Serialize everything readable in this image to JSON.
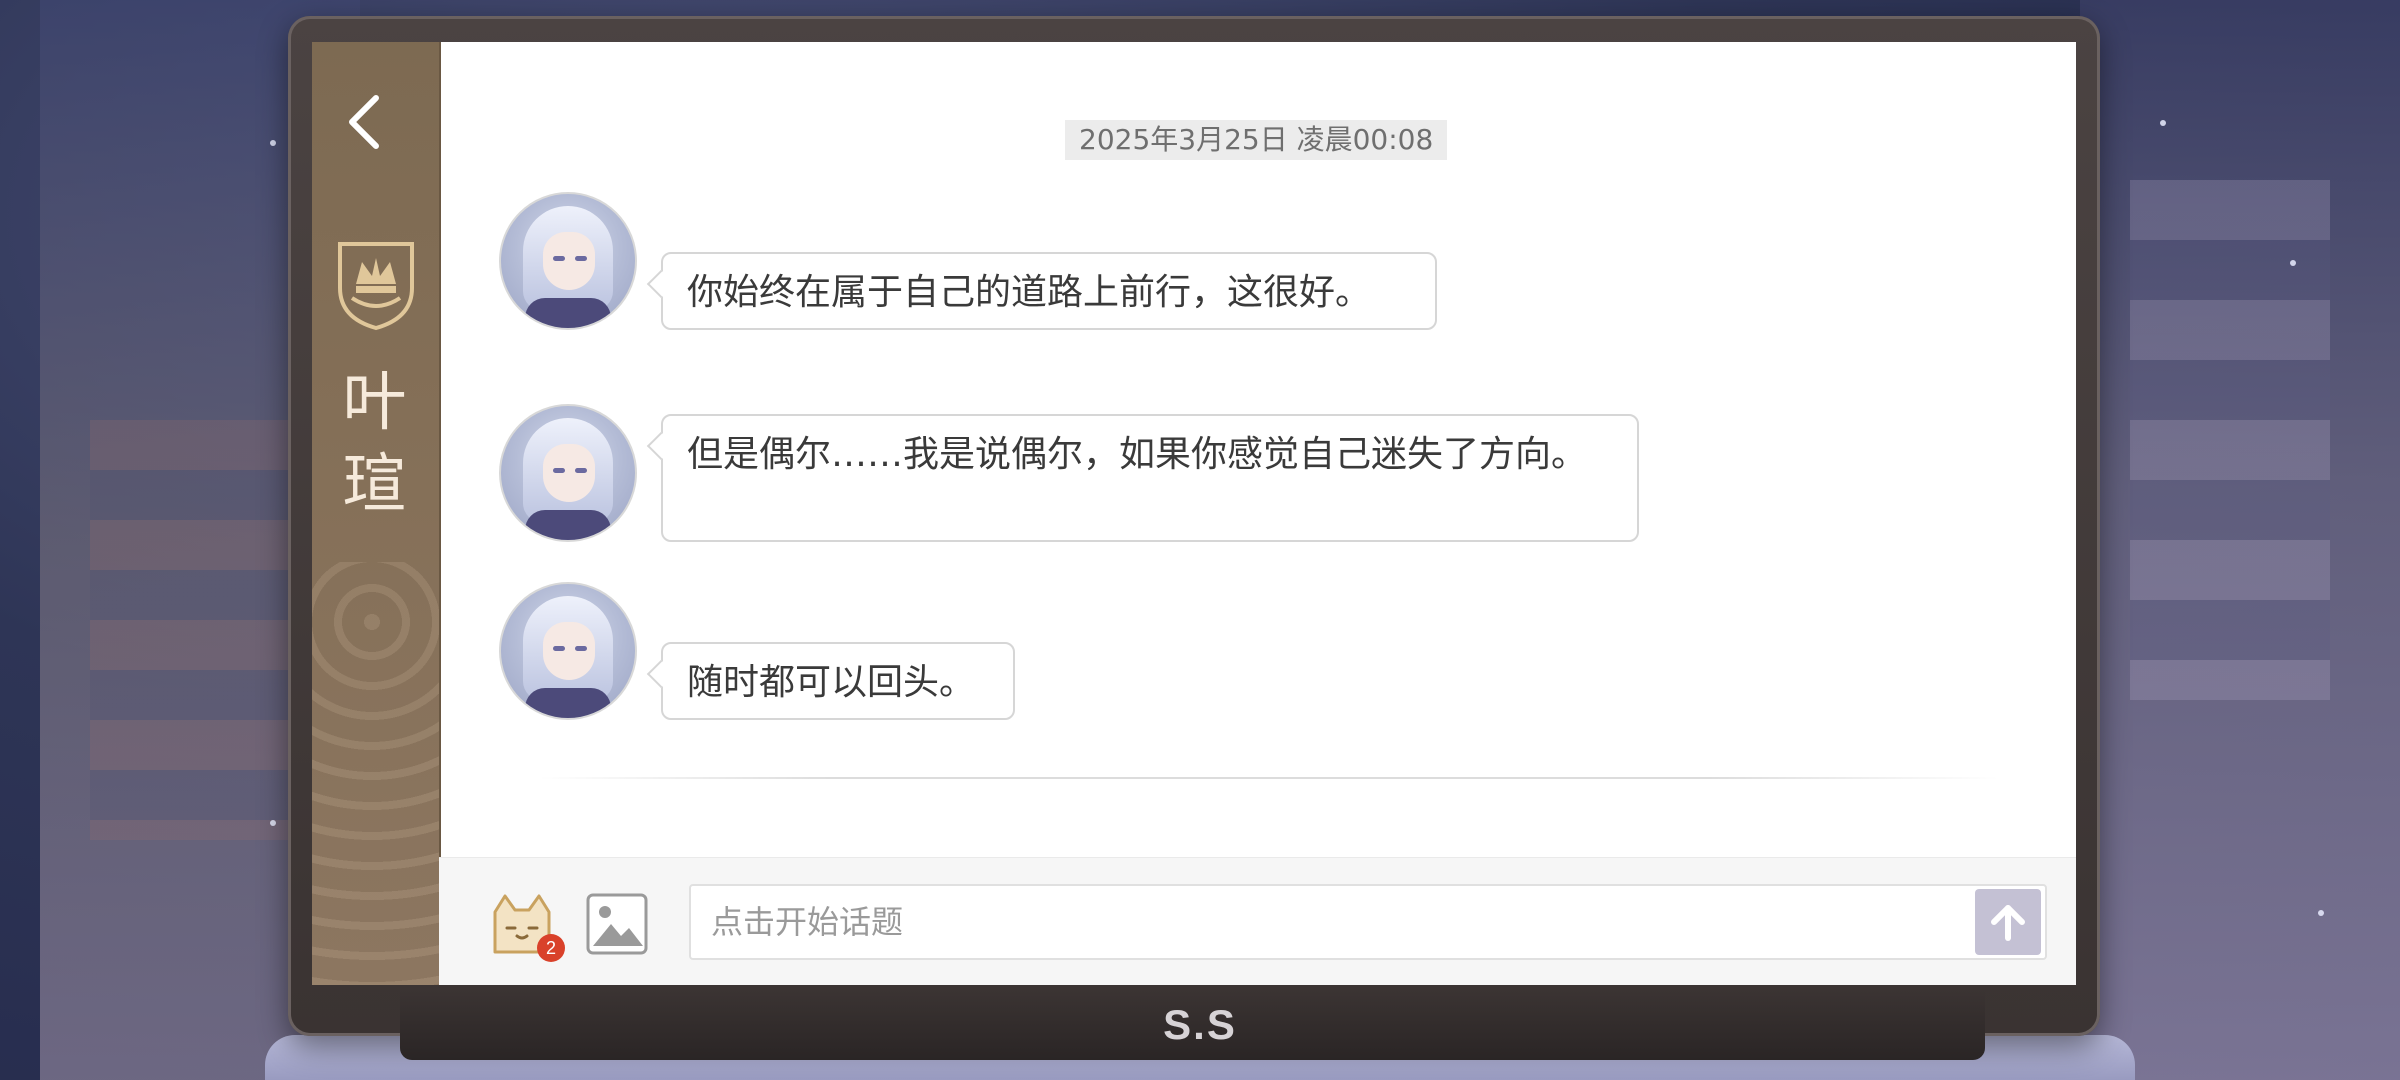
{
  "header": {
    "back_icon": "chevron-left-icon",
    "crest_icon": "crown-crest-icon",
    "character_name": "叶瑄"
  },
  "chat": {
    "timestamp": "2025年3月25日  凌晨00:08",
    "messages": [
      {
        "sender": "叶瑄",
        "text": "你始终在属于自己的道路上前行，这很好。"
      },
      {
        "sender": "叶瑄",
        "text": "但是偶尔……我是说偶尔，如果你感觉自己迷失了方向。"
      },
      {
        "sender": "叶瑄",
        "text": "随时都可以回头。"
      }
    ]
  },
  "input": {
    "placeholder": "点击开始话题",
    "value": "",
    "sticker_icon": "cat-sticker-icon",
    "sticker_badge": "2",
    "image_icon": "image-icon",
    "send_icon": "arrow-up-icon"
  },
  "device": {
    "brand": "S.S"
  },
  "colors": {
    "sidebar": "#846f57",
    "bezel": "#3f3837",
    "send_button": "#c4c1d4",
    "badge": "#d9412a",
    "timestamp_bg": "#ececec"
  }
}
